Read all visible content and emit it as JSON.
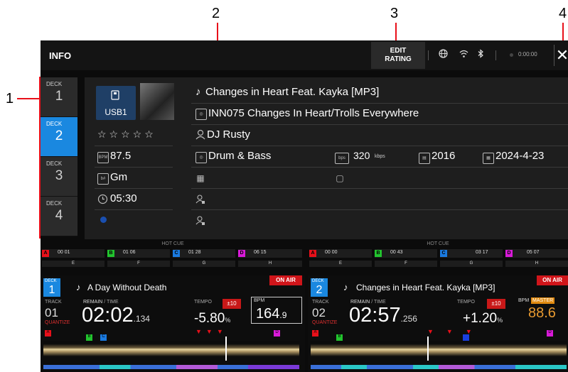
{
  "callouts": [
    "1",
    "2",
    "3",
    "4"
  ],
  "topbar": {
    "title": "INFO",
    "edit_rating_line1": "EDIT",
    "edit_rating_line2": "RATING",
    "time": "0:00:00",
    "close_glyph": "✕",
    "icons": [
      "globe-icon",
      "wifi-icon",
      "bluetooth-icon"
    ]
  },
  "deck_tabs": [
    {
      "label": "DECK",
      "number": "1",
      "active": false
    },
    {
      "label": "DECK",
      "number": "2",
      "active": true
    },
    {
      "label": "DECK",
      "number": "3",
      "active": false
    },
    {
      "label": "DECK",
      "number": "4",
      "active": false
    }
  ],
  "info": {
    "source": "USB1",
    "rating": "☆☆☆☆☆",
    "bpm": "87.5",
    "key": "Gm",
    "time": "05:30",
    "title": "Changes in Heart Feat. Kayka [MP3]",
    "album": "INN075 Changes In Heart/Trolls Everywhere",
    "artist": "DJ Rusty",
    "genre": "Drum & Bass",
    "bitrate": "320",
    "bitrate_unit": "kbps",
    "year": "2016",
    "date_added": "2024-4-23"
  },
  "lower": {
    "hot_cue_label": "HOT CUE",
    "deck_left": {
      "cues": [
        {
          "letter": "A",
          "time": "00 01",
          "color": "#e8101a"
        },
        {
          "letter": "B",
          "time": "01 06",
          "color": "#22c32e"
        },
        {
          "letter": "C",
          "time": "01 28",
          "color": "#1a7ae0"
        },
        {
          "letter": "D",
          "time": "06 15",
          "color": "#d81ad8"
        }
      ],
      "cues2": [
        "E",
        "F",
        "G",
        "H"
      ],
      "deck_label": "DECK",
      "deck_number": "1",
      "title": "A Day Without Death",
      "on_air": "ON AIR",
      "track_label": "TRACK",
      "track_number": "01",
      "quantize": "QUANTIZE",
      "remain_label": "REMAIN",
      "time_label": "/ TIME",
      "remain_main": "02:02",
      "remain_ms": ".134",
      "tempo_label": "TEMPO",
      "tempo_range": "±10",
      "tempo_value": "-5.80",
      "tempo_unit": "%",
      "bpm_label": "BPM",
      "bpm_value": "164",
      "bpm_decimal": ".9",
      "wave_markers": [
        "A",
        "B",
        "C",
        "D"
      ]
    },
    "deck_right": {
      "cues": [
        {
          "letter": "A",
          "time": "00 00",
          "color": "#e8101a"
        },
        {
          "letter": "B",
          "time": "00 43",
          "color": "#22c32e"
        },
        {
          "letter": "C",
          "time": "03 17",
          "color": "#1a7ae0"
        },
        {
          "letter": "D",
          "time": "05 07",
          "color": "#d81ad8"
        }
      ],
      "cues2": [
        "E",
        "F",
        "G",
        "H"
      ],
      "deck_label": "DECK",
      "deck_number": "2",
      "title": "Changes in Heart Feat. Kayka [MP3]",
      "on_air": "ON AIR",
      "track_label": "TRACK",
      "track_number": "02",
      "quantize": "QUANTIZE",
      "remain_label": "REMAIN",
      "time_label": "/ TIME",
      "remain_main": "02:57",
      "remain_ms": ".256",
      "tempo_label": "TEMPO",
      "tempo_range": "±10",
      "tempo_value": "+1.20",
      "tempo_unit": "%",
      "bpm_label": "BPM",
      "master_label": "MASTER",
      "bpm_value": "88.6",
      "wave_markers": [
        "A",
        "B",
        "D"
      ]
    }
  },
  "colors": {
    "accent": "#1a88e0",
    "callout": "#e8101a",
    "on_air": "#d0151a"
  }
}
